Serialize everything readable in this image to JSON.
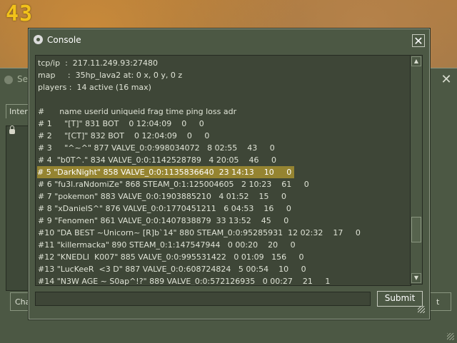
{
  "hud": {
    "counter": "43"
  },
  "background_window": {
    "title": "Se",
    "tab_label": "Inter",
    "left_button_label": "Cha",
    "right_button_label": "t"
  },
  "console": {
    "title": "Console",
    "close_glyph": "✕",
    "output_lines": [
      "tcp/ip  :  217.11.249.93:27480",
      "map     :  35hp_lava2 at: 0 x, 0 y, 0 z",
      "players :  14 active (16 max)",
      "",
      "#      name userid uniqueid frag time ping loss adr",
      "# 1     \"[T]\" 831 BOT    0 12:04:09    0     0",
      "# 2     \"[CT]\" 832 BOT    0 12:04:09    0     0",
      "# 3     \"^~^\" 877 VALVE_0:0:998034072   8 02:55    43     0",
      "# 4  \"b0T^.\" 834 VALVE_0:0:1142528789   4 20:05    46     0",
      "# 5 \"DarkNight\" 858 VALVE_0:0:1135836640  23 14:13    10     0",
      "# 6 \"fu3l.raNdomiZe\" 868 STEAM_0:1:125004605   2 10:23    61     0",
      "# 7 \"pokemon\" 883 VALVE_0:0:1903885210   4 01:52    15     0",
      "# 8 \"xDanielS^\" 876 VALVE_0:0:1770451211   6 04:53    16     0",
      "# 9 \"Fenomen\" 861 VALVE_0:0:1407838879  33 13:52    45     0",
      "#10 \"DA BEST ~Unicorn~ [R]b`14\" 880 STEAM_0:0:95285931  12 02:32    17     0",
      "#11 \"killermacka\" 890 STEAM_0:1:147547944   0 00:20    20     0",
      "#12 \"KNEDLI  K007\" 885 VALVE_0:0:995531422   0 01:09   156     0",
      "#13 \"LucKeeR  <3 D\" 887 VALVE_0:0:608724824   5 00:54    10     0",
      "#14 \"N3W AGE ~ S0ap^!?\" 889 VALVE_0:0:572126935   0 00:27    21     1"
    ],
    "highlighted_line_index": 9,
    "scroll_up_glyph": "▲",
    "scroll_down_glyph": "▼",
    "input_value": "",
    "submit_label": "Submit"
  }
}
